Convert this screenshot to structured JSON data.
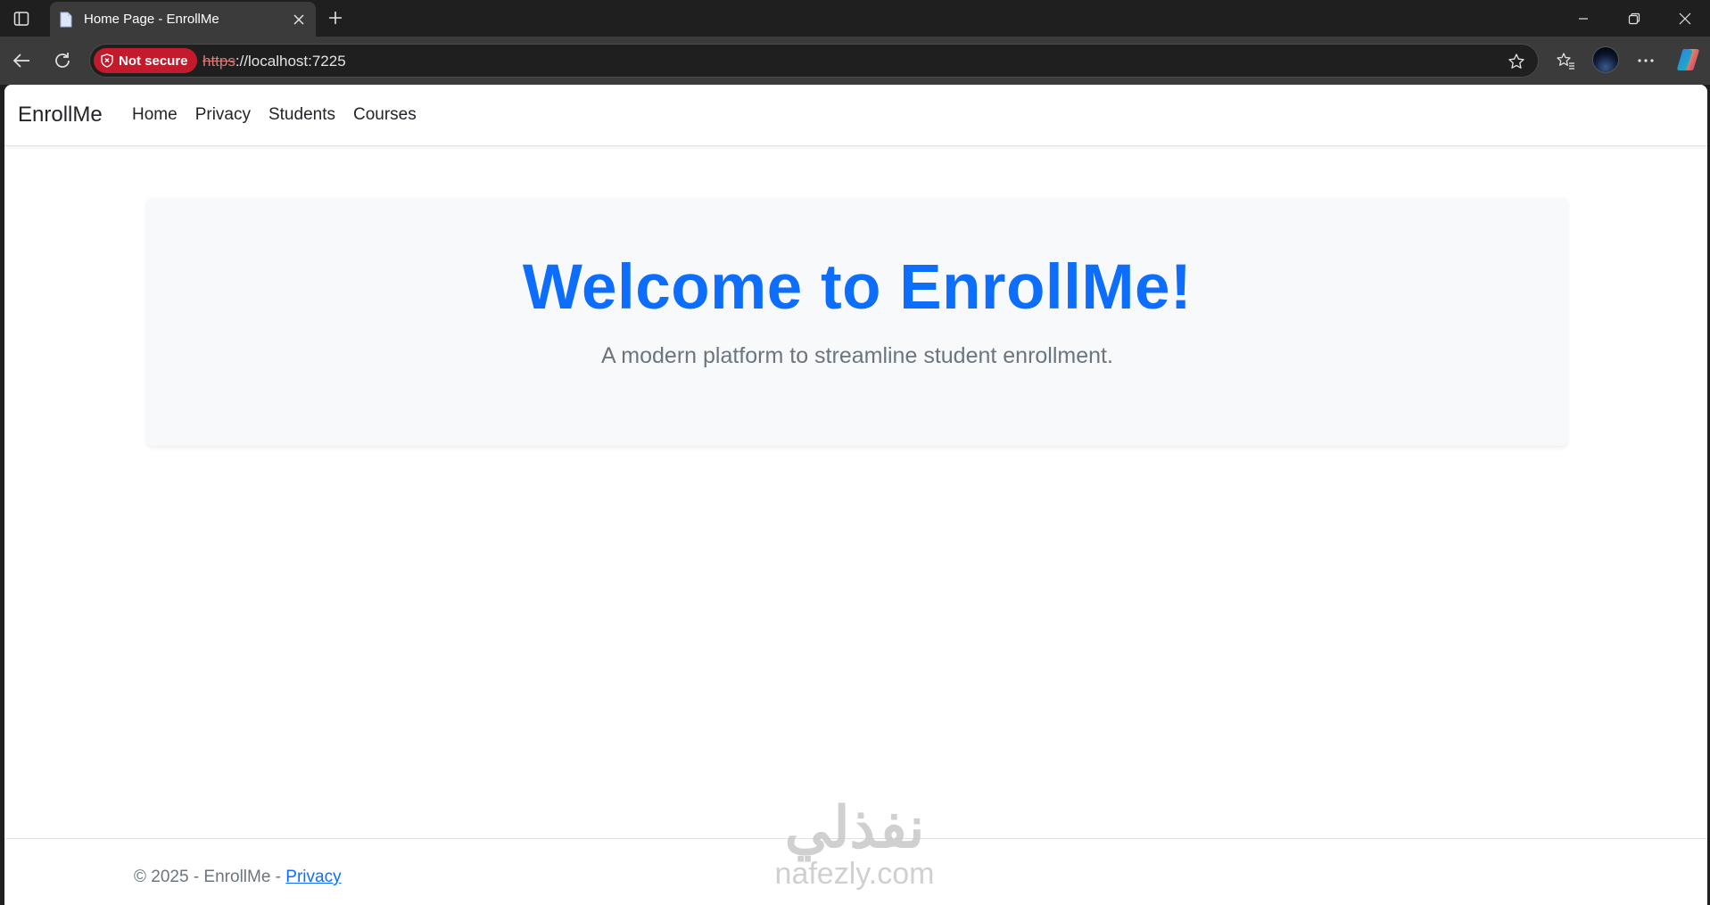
{
  "browser": {
    "tab": {
      "title": "Home Page - EnrollMe"
    },
    "address_bar": {
      "security_label": "Not secure",
      "url_scheme": "https",
      "url_rest": "://localhost:7225"
    },
    "icons": {
      "sidebar": "sidebar-icon",
      "favicon": "page-icon",
      "close": "close-icon",
      "new_tab": "plus-icon",
      "minimize": "minimize-icon",
      "restore": "restore-icon",
      "window_close": "close-icon",
      "back": "back-arrow-icon",
      "refresh": "refresh-icon",
      "shield": "shield-icon",
      "favorite": "star-icon",
      "favorites": "favorites-icon",
      "menu": "more-icon",
      "copilot": "copilot-icon"
    }
  },
  "site": {
    "brand": "EnrollMe",
    "nav": [
      {
        "label": "Home"
      },
      {
        "label": "Privacy"
      },
      {
        "label": "Students"
      },
      {
        "label": "Courses"
      }
    ],
    "hero": {
      "title": "Welcome to EnrollMe!",
      "subtitle": "A modern platform to streamline student enrollment."
    },
    "footer": {
      "text": "© 2025 - EnrollMe - ",
      "link": "Privacy"
    },
    "colors": {
      "primary": "#0d6efd",
      "muted": "#6c757d",
      "hero_bg": "#f8f9fa"
    }
  },
  "watermark": {
    "arabic": "نفذلي",
    "latin": "nafezly.com"
  }
}
